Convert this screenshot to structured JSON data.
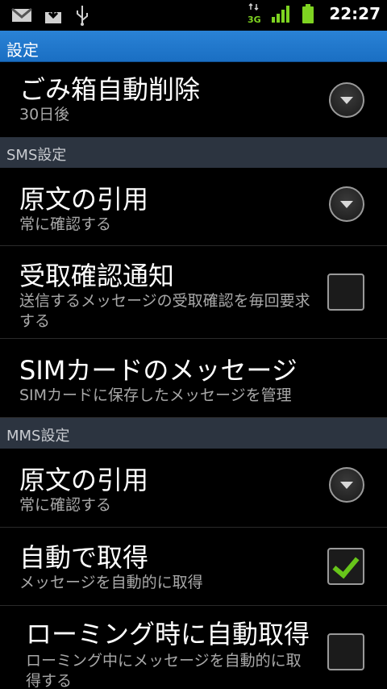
{
  "status_bar": {
    "time": "22:27",
    "left_icons": [
      "gmail-icon",
      "download-icon",
      "usb-icon"
    ],
    "right_icons": [
      "3g-icon",
      "signal-icon",
      "battery-icon"
    ],
    "network_label": "3G"
  },
  "title_bar": {
    "title": "設定"
  },
  "rows": {
    "trash": {
      "title": "ごみ箱自動削除",
      "summary": "30日後"
    },
    "sms_section": "SMS設定",
    "sms_quote": {
      "title": "原文の引用",
      "summary": "常に確認する"
    },
    "sms_receipt": {
      "title": "受取確認通知",
      "summary": "送信するメッセージの受取確認を毎回要求する",
      "checked": false
    },
    "sim": {
      "title": "SIMカードのメッセージ",
      "summary": "SIMカードに保存したメッセージを管理"
    },
    "mms_section": "MMS設定",
    "mms_quote": {
      "title": "原文の引用",
      "summary": "常に確認する"
    },
    "auto_retrieve": {
      "title": "自動で取得",
      "summary": "メッセージを自動的に取得",
      "checked": true
    },
    "roaming": {
      "title": "ローミング時に自動取得",
      "summary": "ローミング中にメッセージを自動的に取得する",
      "checked": false
    }
  },
  "colors": {
    "title_bar": "#1a6fc3",
    "section_bg": "#2c3440",
    "check_green": "#67c51a"
  }
}
